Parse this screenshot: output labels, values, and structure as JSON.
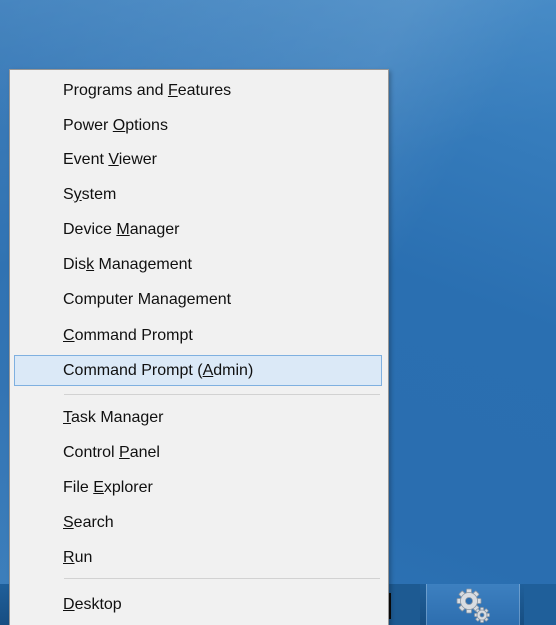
{
  "menu": {
    "items": [
      {
        "pre": "Programs and ",
        "acc": "F",
        "post": "eatures"
      },
      {
        "pre": "Power ",
        "acc": "O",
        "post": "ptions"
      },
      {
        "pre": "Event ",
        "acc": "V",
        "post": "iewer"
      },
      {
        "pre": "S",
        "acc": "y",
        "post": "stem"
      },
      {
        "pre": "Device ",
        "acc": "M",
        "post": "anager"
      },
      {
        "pre": "Dis",
        "acc": "k",
        "post": " Management"
      },
      {
        "pre": "Computer Mana",
        "acc": "g",
        "post": "ement"
      },
      {
        "pre": "",
        "acc": "C",
        "post": "ommand Prompt"
      },
      {
        "pre": "Command Prompt (",
        "acc": "A",
        "post": "dmin)"
      },
      {
        "pre": "",
        "acc": "T",
        "post": "ask Manager"
      },
      {
        "pre": "Control ",
        "acc": "P",
        "post": "anel"
      },
      {
        "pre": "File ",
        "acc": "E",
        "post": "xplorer"
      },
      {
        "pre": "",
        "acc": "S",
        "post": "earch"
      },
      {
        "pre": "",
        "acc": "R",
        "post": "un"
      },
      {
        "pre": "",
        "acc": "D",
        "post": "esktop"
      }
    ],
    "selected_index": 8
  },
  "taskbar": {
    "buttons": [
      {
        "icon": "app-icon"
      },
      {
        "icon": "settings-gears-icon"
      }
    ]
  }
}
